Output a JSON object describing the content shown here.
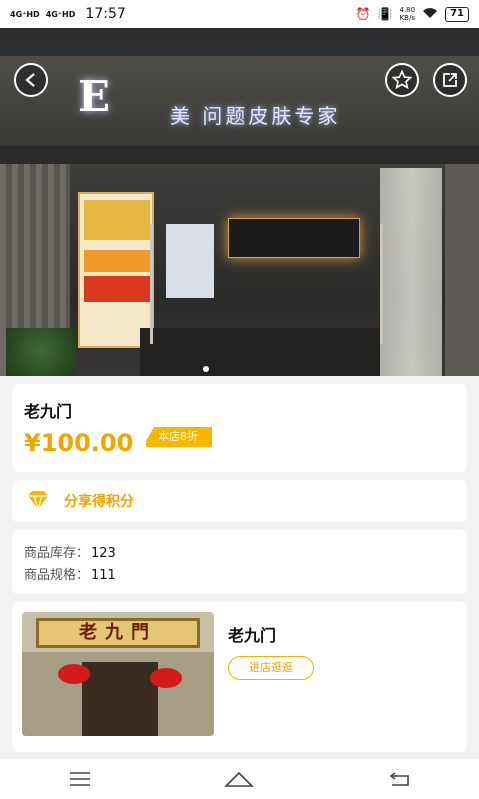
{
  "status_bar": {
    "signal1": "4G⁺HD",
    "signal2": "4G⁺HD",
    "time": "17:57",
    "net_speed_value": "4.80",
    "net_speed_unit": "KB/s",
    "battery": "71"
  },
  "hero": {
    "sign_letter": "E",
    "sign_text": "美 问题皮肤专家"
  },
  "product": {
    "name": "老九门",
    "price": "¥100.00",
    "discount": "本店8折"
  },
  "points": {
    "label": "分享得积分"
  },
  "stock": {
    "stock_label": "商品库存：",
    "stock_value": "123",
    "spec_label": "商品规格：",
    "spec_value": "111"
  },
  "store": {
    "plaque": "老九門",
    "name": "老九门",
    "visit_label": "进店逛逛"
  },
  "icons": {
    "back": "back-arrow-icon",
    "favorite": "star-icon",
    "share": "share-icon",
    "points": "diamond-icon",
    "menu": "menu-icon",
    "home": "home-icon",
    "back_nav": "back-icon"
  },
  "colors": {
    "accent": "#f0a500",
    "badge": "#f5b700"
  }
}
